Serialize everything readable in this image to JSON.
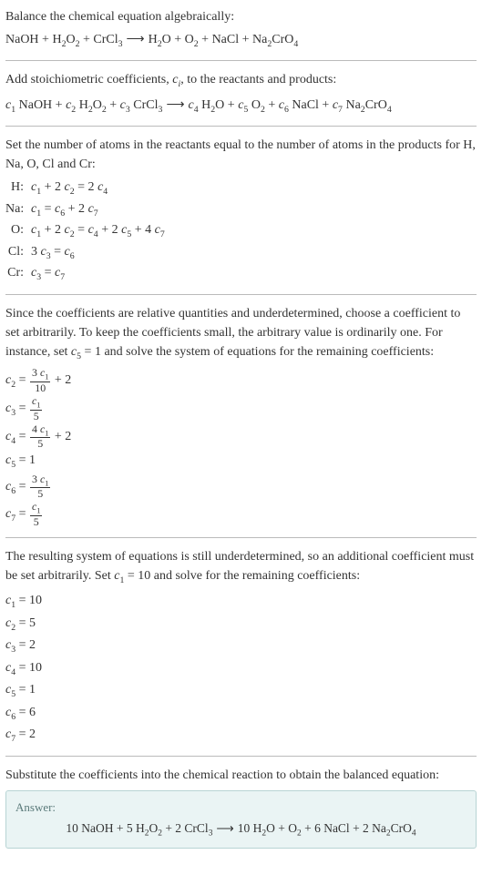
{
  "intro": {
    "title": "Balance the chemical equation algebraically:",
    "equation": "NaOH + H₂O₂ + CrCl₃ ⟶ H₂O + O₂ + NaCl + Na₂CrO₄"
  },
  "stoich": {
    "title": "Add stoichiometric coefficients, cᵢ, to the reactants and products:",
    "equation": "c₁ NaOH + c₂ H₂O₂ + c₃ CrCl₃ ⟶ c₄ H₂O + c₅ O₂ + c₆ NaCl + c₇ Na₂CrO₄"
  },
  "atoms": {
    "title": "Set the number of atoms in the reactants equal to the number of atoms in the products for H, Na, O, Cl and Cr:",
    "rows": [
      {
        "label": "H:",
        "eq": "c₁ + 2 c₂ = 2 c₄"
      },
      {
        "label": "Na:",
        "eq": "c₁ = c₆ + 2 c₇"
      },
      {
        "label": "O:",
        "eq": "c₁ + 2 c₂ = c₄ + 2 c₅ + 4 c₇"
      },
      {
        "label": "Cl:",
        "eq": "3 c₃ = c₆"
      },
      {
        "label": "Cr:",
        "eq": "c₃ = c₇"
      }
    ]
  },
  "underdet1": {
    "text": "Since the coefficients are relative quantities and underdetermined, choose a coefficient to set arbitrarily. To keep the coefficients small, the arbitrary value is ordinarily one. For instance, set c₅ = 1 and solve the system of equations for the remaining coefficients:",
    "coefs_frac": [
      {
        "lhs": "c₂ =",
        "num": "3 c₁",
        "den": "10",
        "tail": " + 2"
      },
      {
        "lhs": "c₃ =",
        "num": "c₁",
        "den": "5",
        "tail": ""
      },
      {
        "lhs": "c₄ =",
        "num": "4 c₁",
        "den": "5",
        "tail": " + 2"
      },
      {
        "lhs": "c₅ =",
        "plain": "1"
      },
      {
        "lhs": "c₆ =",
        "num": "3 c₁",
        "den": "5",
        "tail": ""
      },
      {
        "lhs": "c₇ =",
        "num": "c₁",
        "den": "5",
        "tail": ""
      }
    ]
  },
  "underdet2": {
    "text": "The resulting system of equations is still underdetermined, so an additional coefficient must be set arbitrarily. Set c₁ = 10 and solve for the remaining coefficients:",
    "coefs": [
      "c₁ = 10",
      "c₂ = 5",
      "c₃ = 2",
      "c₄ = 10",
      "c₅ = 1",
      "c₆ = 6",
      "c₇ = 2"
    ]
  },
  "substitute": {
    "text": "Substitute the coefficients into the chemical reaction to obtain the balanced equation:"
  },
  "answer": {
    "label": "Answer:",
    "equation": "10 NaOH + 5 H₂O₂ + 2 CrCl₃ ⟶ 10 H₂O + O₂ + 6 NaCl + 2 Na₂CrO₄"
  }
}
